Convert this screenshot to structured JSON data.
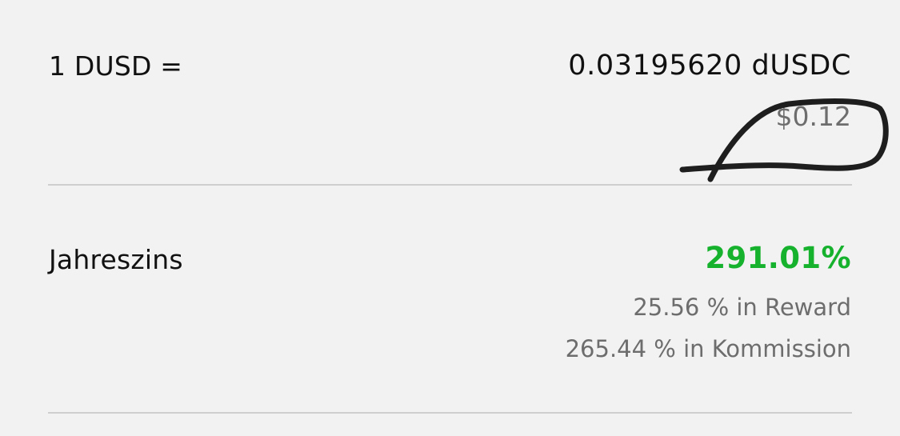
{
  "exchange_rate": {
    "label": "1 DUSD =",
    "value": "0.03195620 dUSDC",
    "usd_value": "$0.12"
  },
  "apr": {
    "label": "Jahreszins",
    "value": "291.01%",
    "reward_text": "25.56 % in Reward",
    "commission_text": "265.44 % in Kommission",
    "value_color": "#16b22d"
  }
}
